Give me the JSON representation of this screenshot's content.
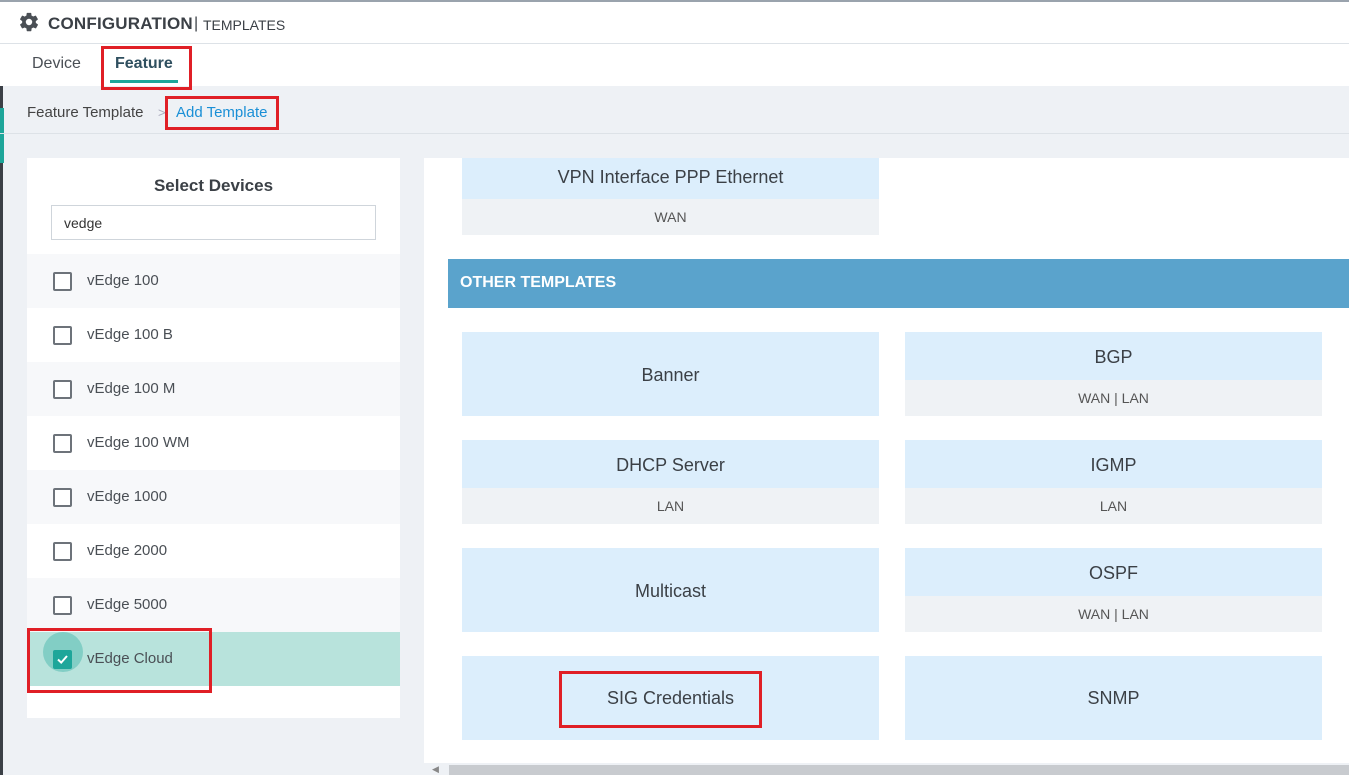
{
  "header": {
    "title": "CONFIGURATION",
    "separator": "|",
    "subtitle": "TEMPLATES",
    "icon": "gear-icon"
  },
  "tabs": [
    {
      "label": "Device"
    },
    {
      "label": "Feature",
      "active": true
    }
  ],
  "breadcrumb": {
    "root": "Feature Template",
    "separator": ">",
    "current": "Add Template"
  },
  "select_devices": {
    "title": "Select Devices",
    "search_value": "vedge",
    "devices": [
      {
        "label": "vEdge 100",
        "checked": false
      },
      {
        "label": "vEdge 100 B",
        "checked": false
      },
      {
        "label": "vEdge 100 M",
        "checked": false
      },
      {
        "label": "vEdge 100 WM",
        "checked": false
      },
      {
        "label": "vEdge 1000",
        "checked": false
      },
      {
        "label": "vEdge 2000",
        "checked": false
      },
      {
        "label": "vEdge 5000",
        "checked": false
      },
      {
        "label": "vEdge Cloud",
        "checked": true
      }
    ]
  },
  "templates": {
    "top_card": {
      "name": "VPN Interface PPP Ethernet",
      "tag": "WAN"
    },
    "section_title": "OTHER TEMPLATES",
    "cards": [
      {
        "name": "Banner",
        "tag": ""
      },
      {
        "name": "BGP",
        "tag": "WAN | LAN"
      },
      {
        "name": "DHCP Server",
        "tag": "LAN"
      },
      {
        "name": "IGMP",
        "tag": "LAN"
      },
      {
        "name": "Multicast",
        "tag": ""
      },
      {
        "name": "OSPF",
        "tag": "WAN | LAN"
      },
      {
        "name": "SIG Credentials",
        "tag": ""
      },
      {
        "name": "SNMP",
        "tag": ""
      }
    ]
  },
  "colors": {
    "accent": "#1ea69a",
    "highlight": "#e01f26",
    "section": "#5aa3cc",
    "card": "#dceefc",
    "link": "#1a8fd6"
  }
}
